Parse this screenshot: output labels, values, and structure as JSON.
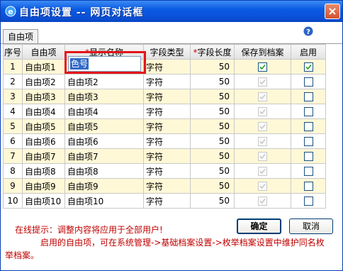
{
  "window": {
    "title": "自由项设置 -- 网页对话框"
  },
  "tab": {
    "label": "自由项"
  },
  "table": {
    "columns": [
      "序号",
      "自由项",
      "显示名称",
      "字段类型",
      "字段长度",
      "保存到档案",
      "启用"
    ],
    "rows": [
      {
        "no": "1",
        "item": "自由项1",
        "display": "色号",
        "type": "字符",
        "length": "50",
        "save": true,
        "save_enabled": true,
        "enable": true
      },
      {
        "no": "2",
        "item": "自由项2",
        "display": "自由项2",
        "type": "字符",
        "length": "50",
        "save": true,
        "save_enabled": false,
        "enable": false
      },
      {
        "no": "3",
        "item": "自由项3",
        "display": "自由项3",
        "type": "字符",
        "length": "50",
        "save": true,
        "save_enabled": false,
        "enable": false
      },
      {
        "no": "4",
        "item": "自由项4",
        "display": "自由项4",
        "type": "字符",
        "length": "50",
        "save": true,
        "save_enabled": false,
        "enable": false
      },
      {
        "no": "5",
        "item": "自由项5",
        "display": "自由项5",
        "type": "字符",
        "length": "50",
        "save": true,
        "save_enabled": false,
        "enable": false
      },
      {
        "no": "6",
        "item": "自由项6",
        "display": "自由项6",
        "type": "字符",
        "length": "50",
        "save": true,
        "save_enabled": false,
        "enable": false
      },
      {
        "no": "7",
        "item": "自由项7",
        "display": "自由项7",
        "type": "字符",
        "length": "50",
        "save": true,
        "save_enabled": false,
        "enable": false
      },
      {
        "no": "8",
        "item": "自由项8",
        "display": "自由项8",
        "type": "字符",
        "length": "50",
        "save": true,
        "save_enabled": false,
        "enable": false
      },
      {
        "no": "9",
        "item": "自由项9",
        "display": "自由项9",
        "type": "字符",
        "length": "50",
        "save": true,
        "save_enabled": false,
        "enable": false
      },
      {
        "no": "10",
        "item": "自由项10",
        "display": "自由项10",
        "type": "字符",
        "length": "50",
        "save": true,
        "save_enabled": false,
        "enable": false
      }
    ]
  },
  "footer": {
    "tip": "在线提示：调整内容将应用于全部用户!",
    "tip2": "启用的自由项，可在系统管理->基础档案设置->枚举档案设置中维护同名枚举档案。",
    "ok_label": "确定",
    "cancel_label": "取消"
  },
  "colors": {
    "title_bar": "#0b5be3",
    "row_highlight": "#fff8d6",
    "callout": "#e4131a",
    "tip_text": "#c00000"
  }
}
